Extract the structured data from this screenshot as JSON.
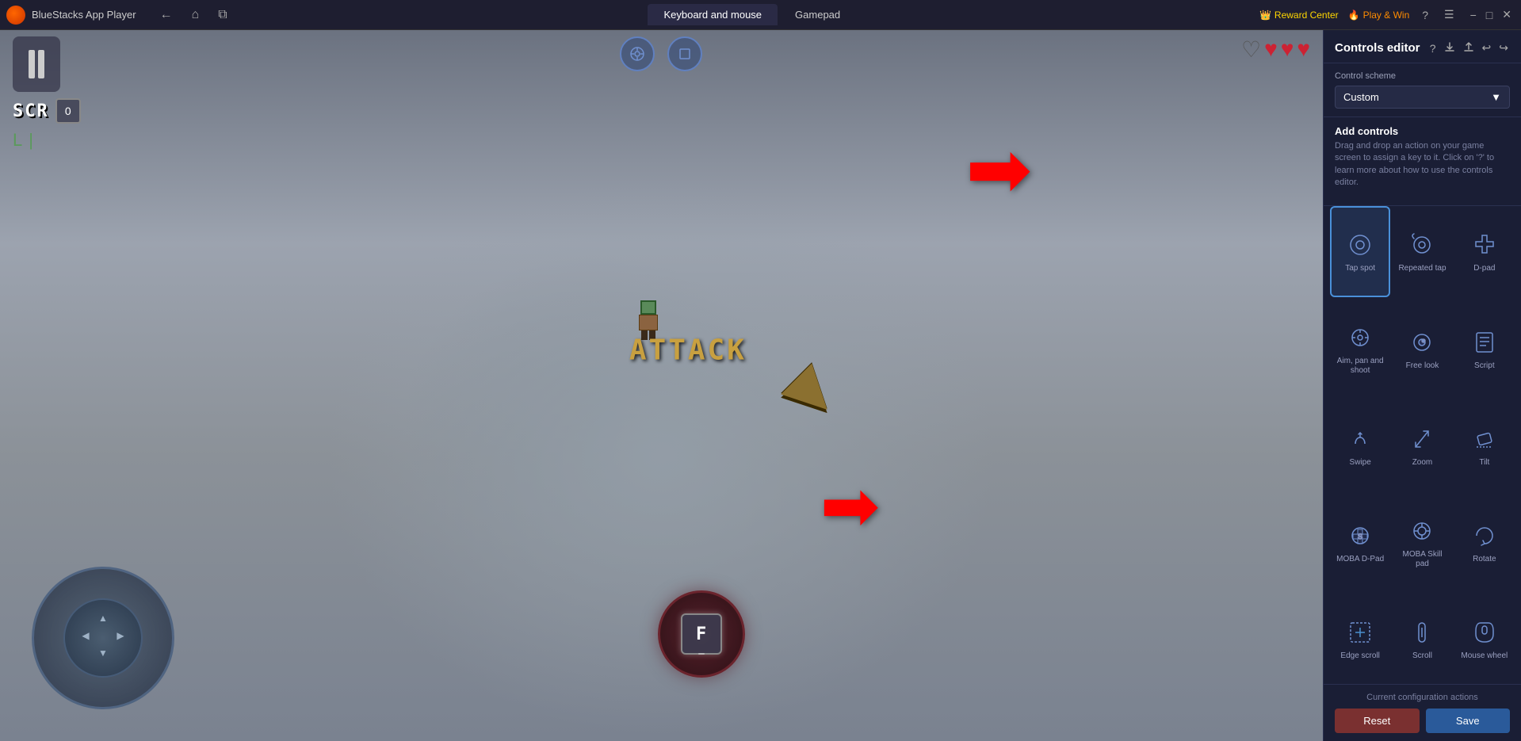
{
  "titleBar": {
    "appName": "BlueStacks App Player",
    "navBack": "←",
    "navHome": "⌂",
    "navNew": "⧉",
    "tabs": [
      {
        "label": "Keyboard and mouse",
        "active": true
      },
      {
        "label": "Gamepad",
        "active": false
      }
    ],
    "rewardCenter": "Reward Center",
    "playWin": "Play & Win",
    "helpIcon": "?",
    "menuIcon": "☰",
    "minimizeIcon": "−",
    "maximizeIcon": "□",
    "closeIcon": "✕"
  },
  "hud": {
    "scoreLabel": "SCR",
    "scoreValue": "0",
    "heartFull1": "♥",
    "heartFull2": "♥",
    "heartFull3": "♥",
    "heartEmpty": "♡"
  },
  "gameArea": {
    "attackText": "ATTACK",
    "actionKey": "F"
  },
  "controlsPanel": {
    "title": "Controls editor",
    "importIcon": "⬆",
    "exportIcon": "⬇",
    "undoIcon": "↩",
    "redoIcon": "↪",
    "schemeLabel": "Control scheme",
    "schemeValue": "Custom",
    "addControlsTitle": "Add controls",
    "addControlsDesc": "Drag and drop an action on your game screen to assign a key to it. Click on '?' to learn more about how to use the controls editor.",
    "controls": [
      {
        "id": "tap-spot",
        "label": "Tap spot",
        "selected": true
      },
      {
        "id": "repeated-tap",
        "label": "Repeated tap",
        "selected": false
      },
      {
        "id": "d-pad",
        "label": "D-pad",
        "selected": false
      },
      {
        "id": "aim-pan-shoot",
        "label": "Aim, pan and shoot",
        "selected": false
      },
      {
        "id": "free-look",
        "label": "Free look",
        "selected": false
      },
      {
        "id": "script",
        "label": "Script",
        "selected": false
      },
      {
        "id": "swipe",
        "label": "Swipe",
        "selected": false
      },
      {
        "id": "zoom",
        "label": "Zoom",
        "selected": false
      },
      {
        "id": "tilt",
        "label": "Tilt",
        "selected": false
      },
      {
        "id": "moba-d-pad",
        "label": "MOBA D-Pad",
        "selected": false
      },
      {
        "id": "moba-skill-pad",
        "label": "MOBA Skill pad",
        "selected": false
      },
      {
        "id": "rotate",
        "label": "Rotate",
        "selected": false
      },
      {
        "id": "edge-scroll",
        "label": "Edge scroll",
        "selected": false
      },
      {
        "id": "scroll",
        "label": "Scroll",
        "selected": false
      },
      {
        "id": "mouse-wheel",
        "label": "Mouse wheel",
        "selected": false
      }
    ],
    "currentConfigLabel": "Current configuration actions",
    "resetLabel": "Reset",
    "saveLabel": "Save"
  }
}
